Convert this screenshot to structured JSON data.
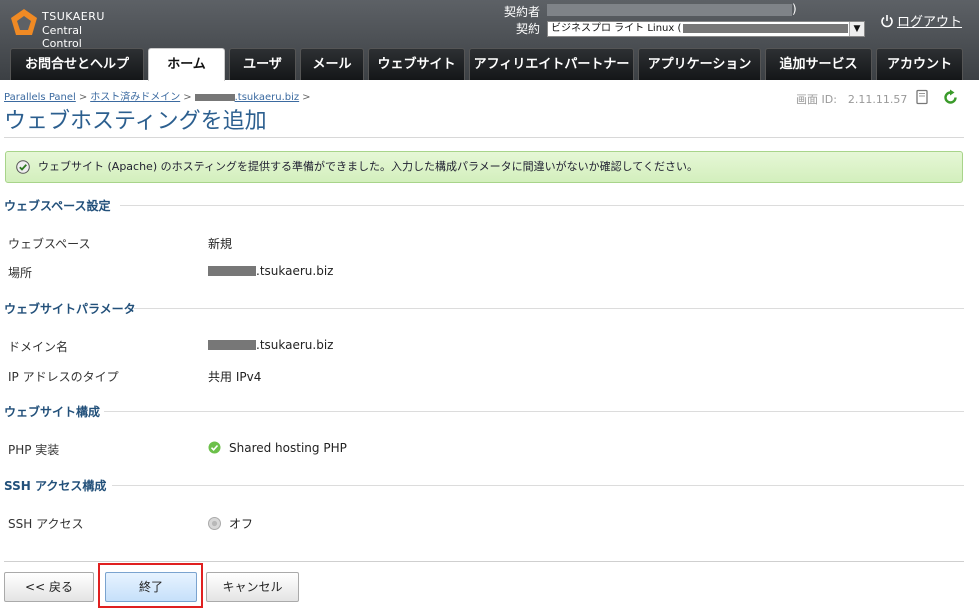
{
  "header": {
    "logo_line1": "TSUKAERU",
    "logo_line2": "Central Control",
    "account_label": "契約者",
    "account_suffix": ")",
    "plan_label": "契約",
    "plan_select_value": "ビジネスプロ ライト Linux (",
    "logout_label": "ログアウト"
  },
  "tabs": [
    {
      "label": "お問合せとヘルプ",
      "active": false
    },
    {
      "label": "ホーム",
      "active": true
    },
    {
      "label": "ユーザ",
      "active": false
    },
    {
      "label": "メール",
      "active": false
    },
    {
      "label": "ウェブサイト",
      "active": false
    },
    {
      "label": "アフィリエイトパートナー",
      "active": false
    },
    {
      "label": "アプリケーション",
      "active": false
    },
    {
      "label": "追加サービス",
      "active": false
    },
    {
      "label": "アカウント",
      "active": false
    }
  ],
  "breadcrumb": {
    "items": [
      "Parallels Panel",
      "ホスト済みドメイン",
      ".tsukaeru.biz"
    ],
    "separator": ">"
  },
  "page": {
    "title": "ウェブホスティングを追加",
    "screen_id": "画面 ID:　2.11.11.57"
  },
  "message": "ウェブサイト (Apache) のホスティングを提供する準備ができました。入力した構成パラメータに間違いがないか確認してください。",
  "sections": {
    "webspace": {
      "title": "ウェブスペース設定",
      "webspace_label": "ウェブスペース",
      "webspace_value": "新規",
      "location_label": "場所",
      "location_value": ".tsukaeru.biz"
    },
    "params": {
      "title": "ウェブサイトパラメータ",
      "domain_label": "ドメイン名",
      "domain_value": ".tsukaeru.biz",
      "ip_label": "IP アドレスのタイプ",
      "ip_value": "共用 IPv4"
    },
    "config": {
      "title": "ウェブサイト構成",
      "php_label": "PHP 実装",
      "php_value": "Shared hosting PHP"
    },
    "ssh": {
      "title": "SSH アクセス構成",
      "ssh_label": "SSH アクセス",
      "ssh_value": "オフ"
    }
  },
  "buttons": {
    "back": "<< 戻る",
    "finish": "終了",
    "cancel": "キャンセル"
  },
  "colors": {
    "header_bg": "#4a4e52",
    "title": "#2c5f8f",
    "success_bg": "#dcf2c8",
    "highlight": "#e02020"
  }
}
